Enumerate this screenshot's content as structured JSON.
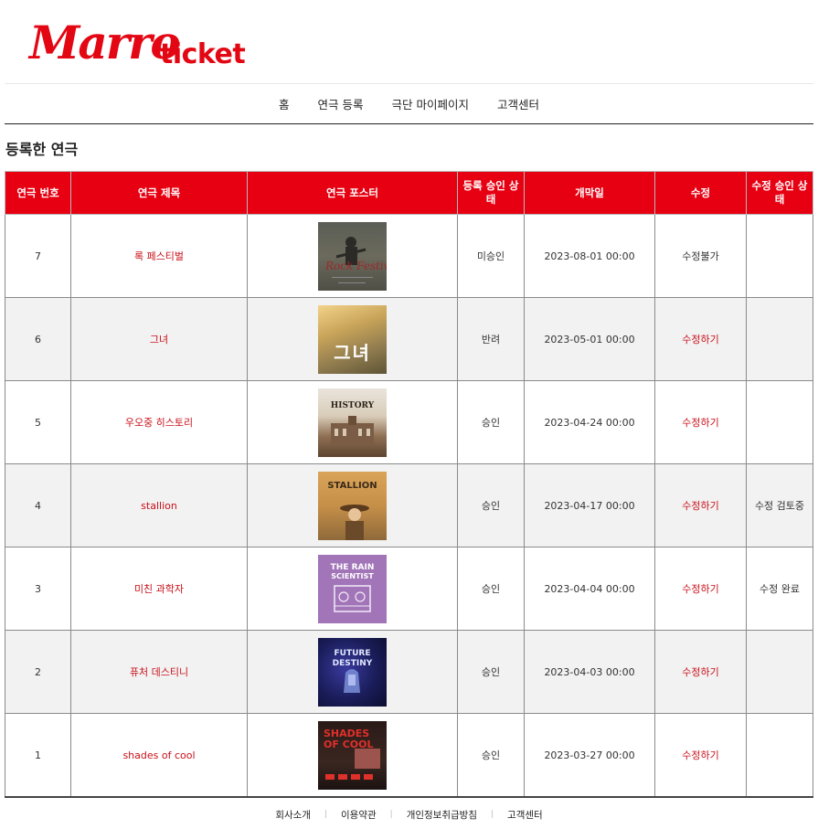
{
  "brand": {
    "script": "Marro",
    "suffix": "ticket",
    "color": "#e30613"
  },
  "nav": [
    "홈",
    "연극 등록",
    "극단 마이페이지",
    "고객센터"
  ],
  "page_title": "등록한 연극",
  "table": {
    "headers": [
      "연극 번호",
      "연극 제목",
      "연극 포스터",
      "등록 승인 상태",
      "개막일",
      "수정",
      "수정 승인 상태"
    ],
    "rows": [
      {
        "no": "7",
        "title": "록 페스티벌",
        "poster": "rock-festival-poster",
        "status": "미승인",
        "date": "2023-08-01 00:00",
        "edit": "수정불가",
        "edit_status": ""
      },
      {
        "no": "6",
        "title": "그녀",
        "poster": "her-poster",
        "status": "반려",
        "date": "2023-05-01 00:00",
        "edit": "수정하기",
        "edit_status": ""
      },
      {
        "no": "5",
        "title": "우오중 히스토리",
        "poster": "history-poster",
        "status": "승인",
        "date": "2023-04-24 00:00",
        "edit": "수정하기",
        "edit_status": ""
      },
      {
        "no": "4",
        "title": "stallion",
        "poster": "stallion-poster",
        "status": "승인",
        "date": "2023-04-17 00:00",
        "edit": "수정하기",
        "edit_status": "수정 검토중"
      },
      {
        "no": "3",
        "title": "미친 과학자",
        "poster": "rain-scientist-poster",
        "status": "승인",
        "date": "2023-04-04 00:00",
        "edit": "수정하기",
        "edit_status": "수정 완료"
      },
      {
        "no": "2",
        "title": "퓨처 데스티니",
        "poster": "future-destiny-poster",
        "status": "승인",
        "date": "2023-04-03 00:00",
        "edit": "수정하기",
        "edit_status": ""
      },
      {
        "no": "1",
        "title": "shades of cool",
        "poster": "shades-of-cool-poster",
        "status": "승인",
        "date": "2023-03-27 00:00",
        "edit": "수정하기",
        "edit_status": ""
      }
    ]
  },
  "posters": {
    "p5": "HISTORY",
    "p4": "STALLION",
    "p3a": "THE RAIN",
    "p3b": "SCIENTIST",
    "p2": "FUTURE DESTINY",
    "p1": "SHADES OF COOL",
    "p6": "그녀"
  },
  "footer": [
    "회사소개",
    "이용약관",
    "개인정보취급방침",
    "고객센터"
  ],
  "colors": {
    "accent": "#e60012",
    "link": "#c8101a",
    "row_alt": "#f2f2f2"
  }
}
